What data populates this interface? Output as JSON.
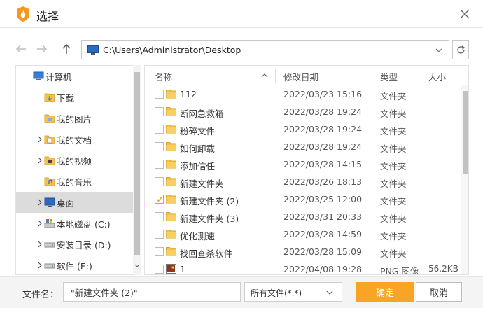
{
  "dialog": {
    "title": "选择"
  },
  "address": {
    "path": "C:\\Users\\Administrator\\Desktop"
  },
  "tree": {
    "items": [
      {
        "label": "计算机",
        "icon": "computer-icon",
        "expandable": false,
        "selected": false
      },
      {
        "label": "下载",
        "icon": "download-folder-icon",
        "expandable": false,
        "selected": false
      },
      {
        "label": "我的图片",
        "icon": "pictures-folder-icon",
        "expandable": false,
        "selected": false
      },
      {
        "label": "我的文档",
        "icon": "documents-folder-icon",
        "expandable": true,
        "selected": false
      },
      {
        "label": "我的视频",
        "icon": "videos-folder-icon",
        "expandable": true,
        "selected": false
      },
      {
        "label": "我的音乐",
        "icon": "music-folder-icon",
        "expandable": false,
        "selected": false
      },
      {
        "label": "桌面",
        "icon": "desktop-icon",
        "expandable": true,
        "selected": true
      },
      {
        "label": "本地磁盘 (C:)",
        "icon": "system-drive-icon",
        "expandable": true,
        "selected": false
      },
      {
        "label": "安装目录 (D:)",
        "icon": "drive-icon",
        "expandable": true,
        "selected": false
      },
      {
        "label": "软件 (E:)",
        "icon": "drive-icon",
        "expandable": true,
        "selected": false
      }
    ]
  },
  "list": {
    "columns": {
      "name": "名称",
      "modified": "修改日期",
      "type": "类型",
      "size": "大小"
    },
    "rows": [
      {
        "name": "112",
        "date": "2022/03/23 15:16",
        "type": "文件夹",
        "size": "",
        "checked": false,
        "icon": "folder-icon"
      },
      {
        "name": "断网急救箱",
        "date": "2022/03/28 19:24",
        "type": "文件夹",
        "size": "",
        "checked": false,
        "icon": "folder-icon"
      },
      {
        "name": "粉碎文件",
        "date": "2022/03/28 19:24",
        "type": "文件夹",
        "size": "",
        "checked": false,
        "icon": "folder-icon"
      },
      {
        "name": "如何卸载",
        "date": "2022/03/28 19:24",
        "type": "文件夹",
        "size": "",
        "checked": false,
        "icon": "folder-icon"
      },
      {
        "name": "添加信任",
        "date": "2022/03/28 14:15",
        "type": "文件夹",
        "size": "",
        "checked": false,
        "icon": "folder-icon"
      },
      {
        "name": "新建文件夹",
        "date": "2022/03/26 18:13",
        "type": "文件夹",
        "size": "",
        "checked": false,
        "icon": "folder-icon"
      },
      {
        "name": "新建文件夹 (2)",
        "date": "2022/03/25 12:00",
        "type": "文件夹",
        "size": "",
        "checked": true,
        "icon": "folder-icon"
      },
      {
        "name": "新建文件夹 (3)",
        "date": "2022/03/31 20:33",
        "type": "文件夹",
        "size": "",
        "checked": false,
        "icon": "folder-icon"
      },
      {
        "name": "优化测速",
        "date": "2022/03/28 14:59",
        "type": "文件夹",
        "size": "",
        "checked": false,
        "icon": "folder-icon"
      },
      {
        "name": "找回查杀软件",
        "date": "2022/03/28 15:09",
        "type": "文件夹",
        "size": "",
        "checked": false,
        "icon": "folder-icon"
      },
      {
        "name": "1",
        "date": "2022/04/08 19:28",
        "type": "PNG 图像",
        "size": "56.2KB",
        "checked": false,
        "icon": "image-file-icon"
      }
    ]
  },
  "footer": {
    "filename_label": "文件名：",
    "filename_value": "\"新建文件夹 (2)\"",
    "filter_value": "所有文件(*.*)",
    "ok_label": "确定",
    "cancel_label": "取消"
  },
  "colors": {
    "accent": "#f8a425",
    "folder": "#f2c14e",
    "selection": "#dcdcdc"
  }
}
